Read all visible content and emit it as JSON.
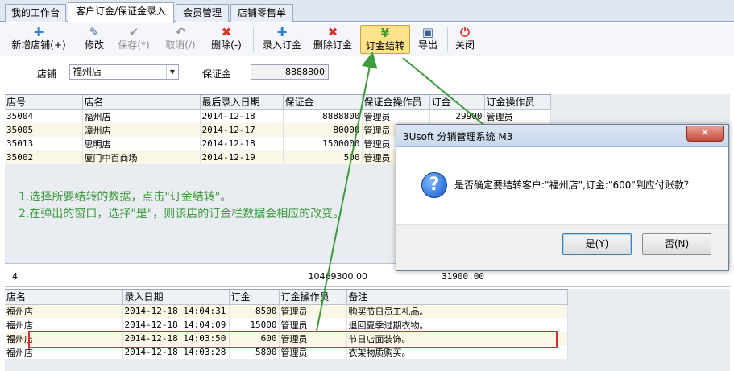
{
  "tabs": [
    {
      "label": "我的工作台"
    },
    {
      "label": "客户订金/保证金录入"
    },
    {
      "label": "会员管理"
    },
    {
      "label": "店铺零售单"
    }
  ],
  "toolbar": {
    "new_store": "新增店铺(+)",
    "edit": "修改",
    "save": "保存(*)",
    "cancel": "取消(/)",
    "delete": "删除(-)",
    "enter_deposit": "录入订金",
    "delete_deposit": "删除订金",
    "settle_deposit": "订金结转",
    "export": "导出",
    "close": "关闭"
  },
  "filter": {
    "store_label": "店铺",
    "store_value": "福州店",
    "deposit_label": "保证金",
    "deposit_value": "8888800"
  },
  "top_grid": {
    "columns": [
      "店号",
      "店名",
      "最后录入日期",
      "保证金",
      "保证金操作员",
      "订金",
      "订金操作员"
    ],
    "rows": [
      [
        "35004",
        "福州店",
        "2014-12-18",
        "8888800",
        "管理员",
        "29900",
        "管理员"
      ],
      [
        "35005",
        "漳州店",
        "2014-12-17",
        "80000",
        "管理员",
        "",
        ""
      ],
      [
        "35013",
        "思明店",
        "2014-12-18",
        "1500000",
        "管理员",
        "",
        ""
      ],
      [
        "35002",
        "厦门中百商场",
        "2014-12-19",
        "500",
        "管理员",
        "",
        ""
      ]
    ]
  },
  "top_footer": {
    "count": "4",
    "deposit_total": "10469300.00",
    "order_total": "31900.00"
  },
  "bottom_grid": {
    "columns": [
      "店名",
      "录入日期",
      "订金",
      "订金操作员",
      "备注"
    ],
    "rows": [
      [
        "福州店",
        "2014-12-18 14:04:31",
        "8500",
        "管理员",
        "购买节日员工礼品。"
      ],
      [
        "福州店",
        "2014-12-18 14:04:09",
        "15000",
        "管理员",
        "退回夏季过期衣物。"
      ],
      [
        "福州店",
        "2014-12-18 14:03:50",
        "600",
        "管理员",
        "节日店面装饰。"
      ],
      [
        "福州店",
        "2014-12-18 14:03:28",
        "5800",
        "管理员",
        "衣架物质购买。"
      ]
    ]
  },
  "instructions": {
    "line1": "1.选择所要结转的数据，点击\"订金结转\"。",
    "line2": "2.在弹出的窗口，选择\"是\"，则该店的订金栏数据会相应的改变。"
  },
  "dialog": {
    "title": "3Usoft 分销管理系统 M3",
    "message": "是否确定要结转客户:\"福州店\",订金:\"600\"到应付账款？",
    "yes": "是(Y)",
    "no": "否(N)",
    "close_glyph": "✕"
  },
  "colors": {
    "highlight": "#ffe38c",
    "annotation_green": "#3d9a3d",
    "annotation_red": "#e8272a"
  }
}
